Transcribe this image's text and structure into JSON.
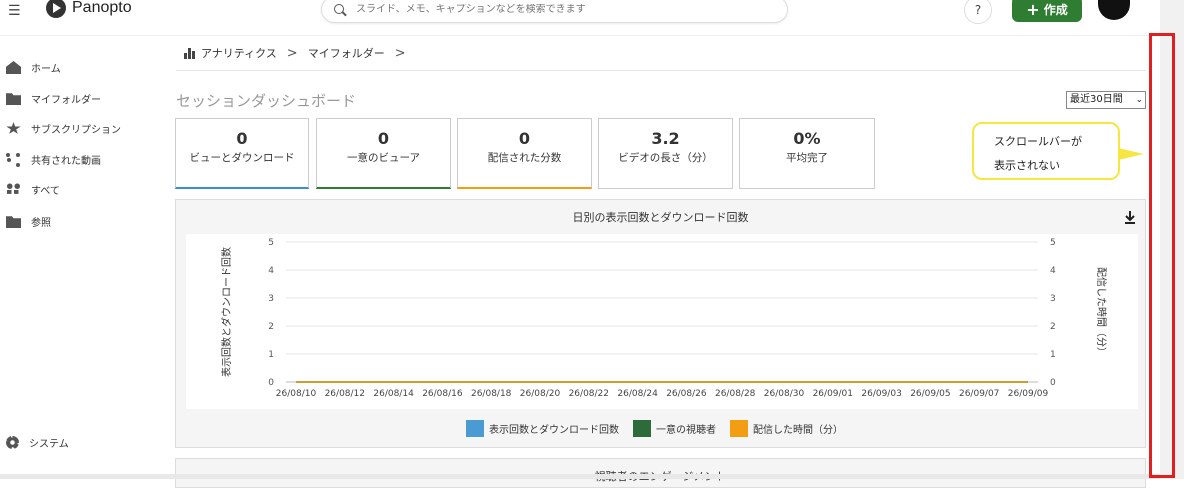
{
  "header": {
    "brand": "Panopto",
    "search_placeholder": "スライド、メモ、キャプションなどを検索できます",
    "help_label": "?",
    "create_label": "作成",
    "create_plus": "+",
    "menu_icon": "hamburger-icon"
  },
  "sidebar": {
    "items": [
      {
        "label": "ホーム",
        "icon": "home-icon"
      },
      {
        "label": "マイフォルダー",
        "icon": "folder-icon"
      },
      {
        "label": "サブスクリプション",
        "icon": "star-icon"
      },
      {
        "label": "共有された動画",
        "icon": "share-icon"
      },
      {
        "label": "すべて",
        "icon": "grid-icon"
      },
      {
        "label": "参照",
        "icon": "folder-icon"
      }
    ],
    "system_label": "システム"
  },
  "breadcrumb": {
    "items": [
      "アナリティクス",
      "マイフォルダー"
    ],
    "separator": ">"
  },
  "page": {
    "title": "セッションダッシュボード",
    "period": "最近30日間"
  },
  "stats": [
    {
      "value": "0",
      "label": "ビューとダウンロード",
      "accent": "#3b8ed6"
    },
    {
      "value": "0",
      "label": "一意のビューア",
      "accent": "#2e7d32"
    },
    {
      "value": "0",
      "label": "配信された分数",
      "accent": "#f29d12"
    },
    {
      "value": "3.2",
      "label": "ビデオの長さ（分）",
      "accent": "#cccccc"
    },
    {
      "value": "0%",
      "label": "平均完了",
      "accent": "#cccccc"
    }
  ],
  "callout": {
    "line1": "スクロールバーが",
    "line2": "表示されない",
    "border_color": "#f5e642"
  },
  "panel2": {
    "title": "視聴者のエンゲージメント"
  },
  "chart_data": {
    "type": "line",
    "title": "日別の表示回数とダウンロード回数",
    "ylabel": "表示回数とダウンロード回数",
    "y2label": "配信した時間（分）",
    "ylim": [
      0,
      5
    ],
    "y2lim": [
      0,
      5
    ],
    "yticks": [
      "0",
      "1",
      "2",
      "3",
      "4",
      "5"
    ],
    "categories": [
      "26/08/10",
      "26/08/12",
      "26/08/14",
      "26/08/16",
      "26/08/18",
      "26/08/20",
      "26/08/22",
      "26/08/24",
      "26/08/26",
      "26/08/28",
      "26/08/30",
      "26/09/01",
      "26/09/03",
      "26/09/05",
      "26/09/07",
      "26/09/09"
    ],
    "series": [
      {
        "name": "表示回数とダウンロード回数",
        "color": "#4a9ad4",
        "values": [
          0,
          0,
          0,
          0,
          0,
          0,
          0,
          0,
          0,
          0,
          0,
          0,
          0,
          0,
          0,
          0
        ]
      },
      {
        "name": "一意の視聴者",
        "color": "#2e6b3a",
        "values": [
          0,
          0,
          0,
          0,
          0,
          0,
          0,
          0,
          0,
          0,
          0,
          0,
          0,
          0,
          0,
          0
        ]
      },
      {
        "name": "配信した時間（分）",
        "color": "#f29d12",
        "values": [
          0,
          0,
          0,
          0,
          0,
          0,
          0,
          0,
          0,
          0,
          0,
          0,
          0,
          0,
          0,
          0
        ]
      }
    ],
    "grid": true,
    "legend": "bottom"
  }
}
